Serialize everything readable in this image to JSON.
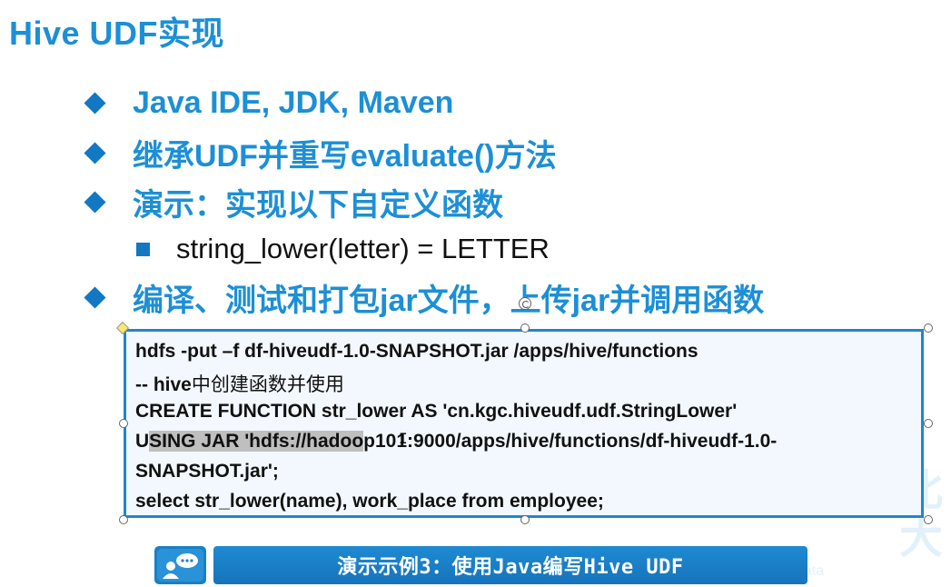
{
  "slide": {
    "title": "Hive UDF实现",
    "bullets": [
      "Java IDE, JDK, Maven",
      "继承UDF并重写evaluate()方法",
      "演示：实现以下自定义函数",
      "编译、测试和打包jar文件，上传jar并调用函数"
    ],
    "sub_bullet": "string_lower(letter) = LETTER"
  },
  "code": {
    "line1": "hdfs -put –f df-hiveudf-1.0-SNAPSHOT.jar /apps/hive/functions",
    "line2_prefix": "-- hive",
    "line2_cn": "中创建函数并使用",
    "line3": "CREATE FUNCTION str_lower AS 'cn.kgc.hiveudf.udf.StringLower'",
    "line4_a": "U",
    "line4_sel": "SING JAR 'hdfs://hadoo",
    "line4_b": "p101:9000/apps/hive/functions/df-hiveudf-1.0-",
    "line5": "SNAPSHOT.jar';",
    "line6": "select str_lower(name), work_place from employee;"
  },
  "footer": {
    "demo_label": "演示示例3：使用Java编写Hive UDF",
    "icon": "chat-user-icon"
  },
  "colors": {
    "accent": "#1c8fd6",
    "bullet": "#1278c4",
    "code_border": "#1f86cf",
    "bar": "#1a7fc6"
  }
}
